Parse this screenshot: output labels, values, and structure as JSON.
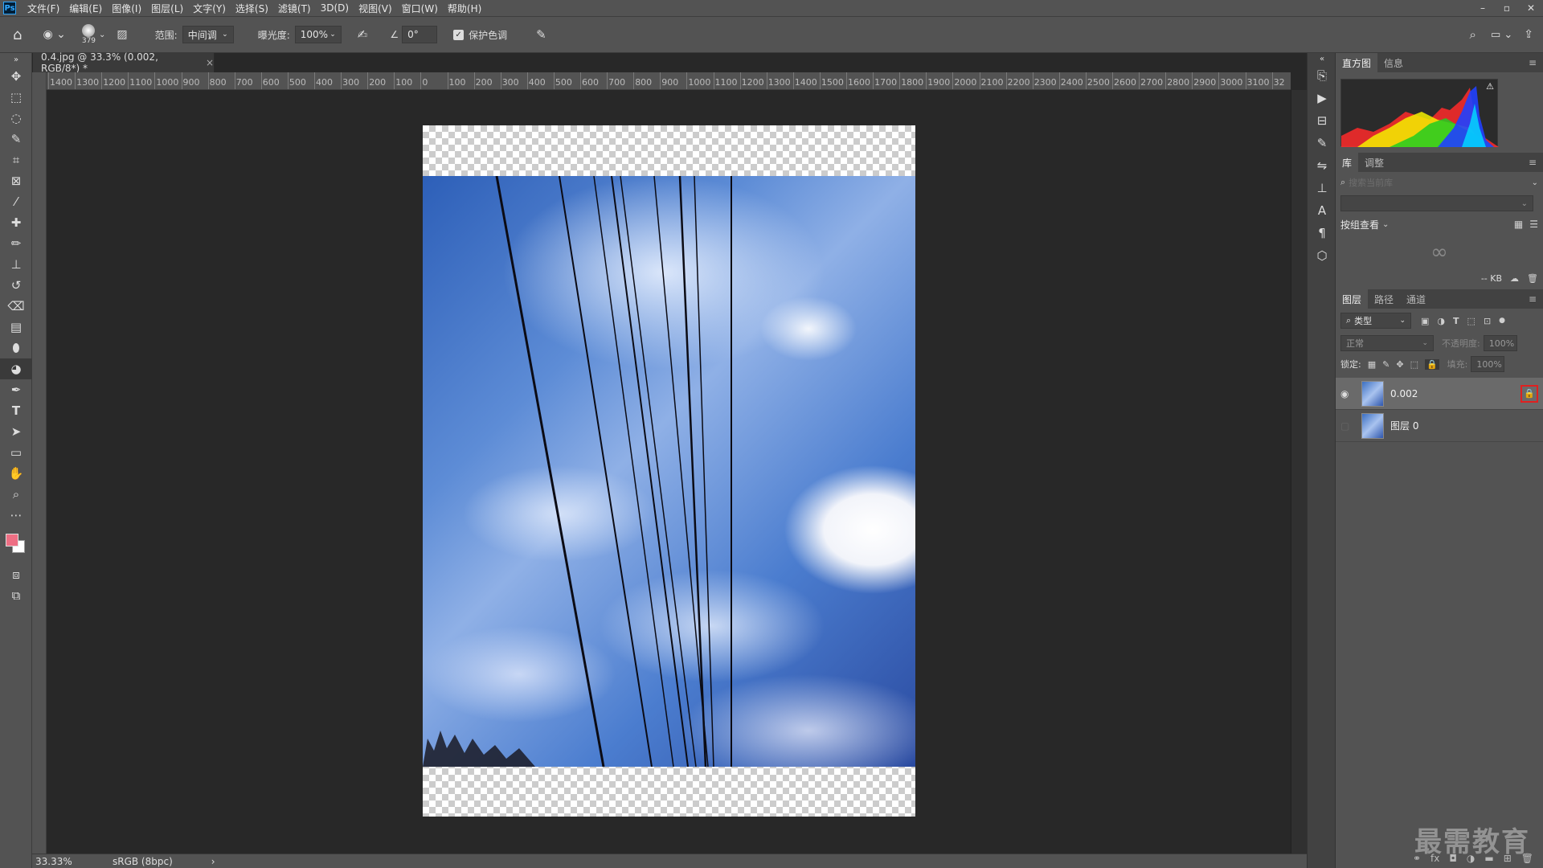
{
  "menu": {
    "logo": "Ps",
    "items": [
      "文件(F)",
      "编辑(E)",
      "图像(I)",
      "图层(L)",
      "文字(Y)",
      "选择(S)",
      "滤镜(T)",
      "3D(D)",
      "视图(V)",
      "窗口(W)",
      "帮助(H)"
    ],
    "minimize": "–",
    "restore": "▫",
    "close": "✕"
  },
  "options": {
    "brush_size": "379",
    "range_label": "范围:",
    "range_value": "中间调",
    "exposure_label": "曝光度:",
    "exposure_value": "100%",
    "angle_value": "0°",
    "protect_tones_label": "保护色调"
  },
  "document": {
    "tab_title": "0.4.jpg @ 33.3% (0.002, RGB/8*) *",
    "close": "×",
    "zoom": "33.33%",
    "color_profile": "sRGB (8bpc)"
  },
  "ruler": {
    "labels": [
      "1400",
      "1300",
      "1200",
      "1100",
      "1000",
      "900",
      "800",
      "700",
      "600",
      "500",
      "400",
      "300",
      "200",
      "100",
      "0",
      "100",
      "200",
      "300",
      "400",
      "500",
      "600",
      "700",
      "800",
      "900",
      "1000",
      "1100",
      "1200",
      "1300",
      "1400",
      "1500",
      "1600",
      "1700",
      "1800",
      "1900",
      "2000",
      "2100",
      "2200",
      "2300",
      "2400",
      "2500",
      "2600",
      "2700",
      "2800",
      "2900",
      "3000",
      "3100",
      "32"
    ]
  },
  "panels": {
    "histogram_tab": "直方图",
    "info_tab": "信息",
    "library_tab": "库",
    "adjust_tab": "调整",
    "library_search_placeholder": "搜索当前库",
    "view_by": "按组查看",
    "size": "-- KB",
    "layers_tab": "图层",
    "paths_tab": "路径",
    "channels_tab": "通道",
    "filter_kind": "类型",
    "blend_mode": "正常",
    "opacity_label": "不透明度:",
    "opacity_value": "100%",
    "lock_label": "锁定:",
    "fill_label": "填充:",
    "fill_value": "100%",
    "layers": [
      {
        "name": "0.002",
        "visible": true,
        "locked": true,
        "selected": true
      },
      {
        "name": "图层 0",
        "visible": false,
        "locked": false,
        "selected": false
      }
    ]
  },
  "colors": {
    "foreground": "#ee6f84",
    "background": "#ffffff",
    "lock_highlight": "#e02020"
  },
  "watermark": "最需教育",
  "status_arrow": "›"
}
